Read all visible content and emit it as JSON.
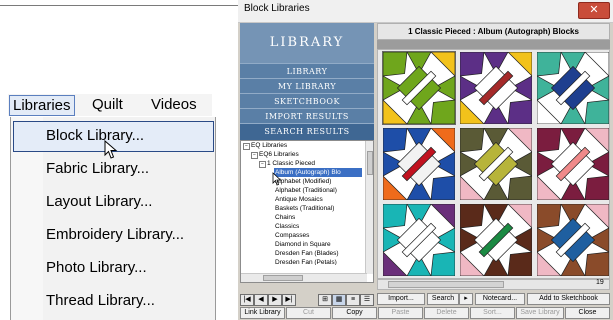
{
  "menubar": {
    "items": [
      "Libraries",
      "Quilt",
      "Videos"
    ]
  },
  "dropdown": {
    "items": [
      "Block Library...",
      "Fabric Library...",
      "Layout Library...",
      "Embroidery Library...",
      "Photo Library...",
      "Thread Library..."
    ]
  },
  "window": {
    "title": "Block Libraries",
    "nav_header": "LIBRARY",
    "nav_items": [
      "LIBRARY",
      "MY LIBRARY",
      "SKETCHBOOK",
      "IMPORT RESULTS",
      "SEARCH RESULTS"
    ],
    "tree": [
      "EQ Libraries",
      "EQ6 Libraries",
      "1 Classic Pieced",
      "Album (Autograph) Blo",
      "Alphabet (Modified)",
      "Alphabet (Traditional)",
      "Antique Mosaics",
      "Baskets (Traditional)",
      "Chains",
      "Classics",
      "Compasses",
      "Diamond in Square",
      "Dresden Fan (Blades)",
      "Dresden Fan (Petals)"
    ],
    "nav_buttons": [
      "|◀",
      "◀",
      "▶",
      "▶|"
    ],
    "view_buttons": [
      "⊞",
      "▦",
      "≡",
      "☰"
    ],
    "view_header": "1 Classic Pieced  :  Album (Autograph) Blocks",
    "count": "19",
    "mid_buttons": [
      "Import...",
      "Search",
      "▸",
      "Notecard...",
      "Add to Sketchbook"
    ],
    "bottom_buttons": [
      "Link Library",
      "Cut",
      "Copy",
      "Paste",
      "Delete",
      "Sort...",
      "Save Library",
      "Close"
    ]
  },
  "colors": {
    "nav_blue": "#5a7fa6",
    "nav_active": "#3f6793",
    "selection": "#3b6fc4",
    "close_red": "#c94d3a"
  },
  "blocks": [
    {
      "corner": "#f2c21b",
      "star": "#6fa61c",
      "center": "#6fa61c",
      "stripe": "#ffffff",
      "bg": "#ffffff"
    },
    {
      "corner": "#f2c21b",
      "star": "#5c2f86",
      "center": "#ffffff",
      "stripe": "#a52a2a",
      "bg": "#ffffff"
    },
    {
      "corner": "#ffffff",
      "star": "#3fb39a",
      "center": "#1e3f8f",
      "stripe": "#ffffff",
      "bg": "#ffffff"
    },
    {
      "corner": "#ef6b1b",
      "star": "#1e4ea8",
      "center": "#f2f2f2",
      "stripe": "#c1121f",
      "bg": "#ffffff"
    },
    {
      "corner": "#f0b8c4",
      "star": "#5a5a36",
      "center": "#b7b43a",
      "stripe": "#ffffff",
      "bg": "#ffffff"
    },
    {
      "corner": "#f0b8c4",
      "star": "#7b1d3f",
      "center": "#ffffff",
      "stripe": "#f08a8a",
      "bg": "#ffffff"
    },
    {
      "corner": "#6a2f7a",
      "star": "#19b5b5",
      "center": "#ffffff",
      "stripe": "#ffffff",
      "bg": "#ffffff"
    },
    {
      "corner": "#f0b8c4",
      "star": "#5a2a1a",
      "center": "#ffffff",
      "stripe": "#1b8a43",
      "bg": "#ffffff"
    },
    {
      "corner": "#f0b8c4",
      "star": "#8a4b2a",
      "center": "#1f5fa0",
      "stripe": "#ffffff",
      "bg": "#ffffff"
    }
  ]
}
